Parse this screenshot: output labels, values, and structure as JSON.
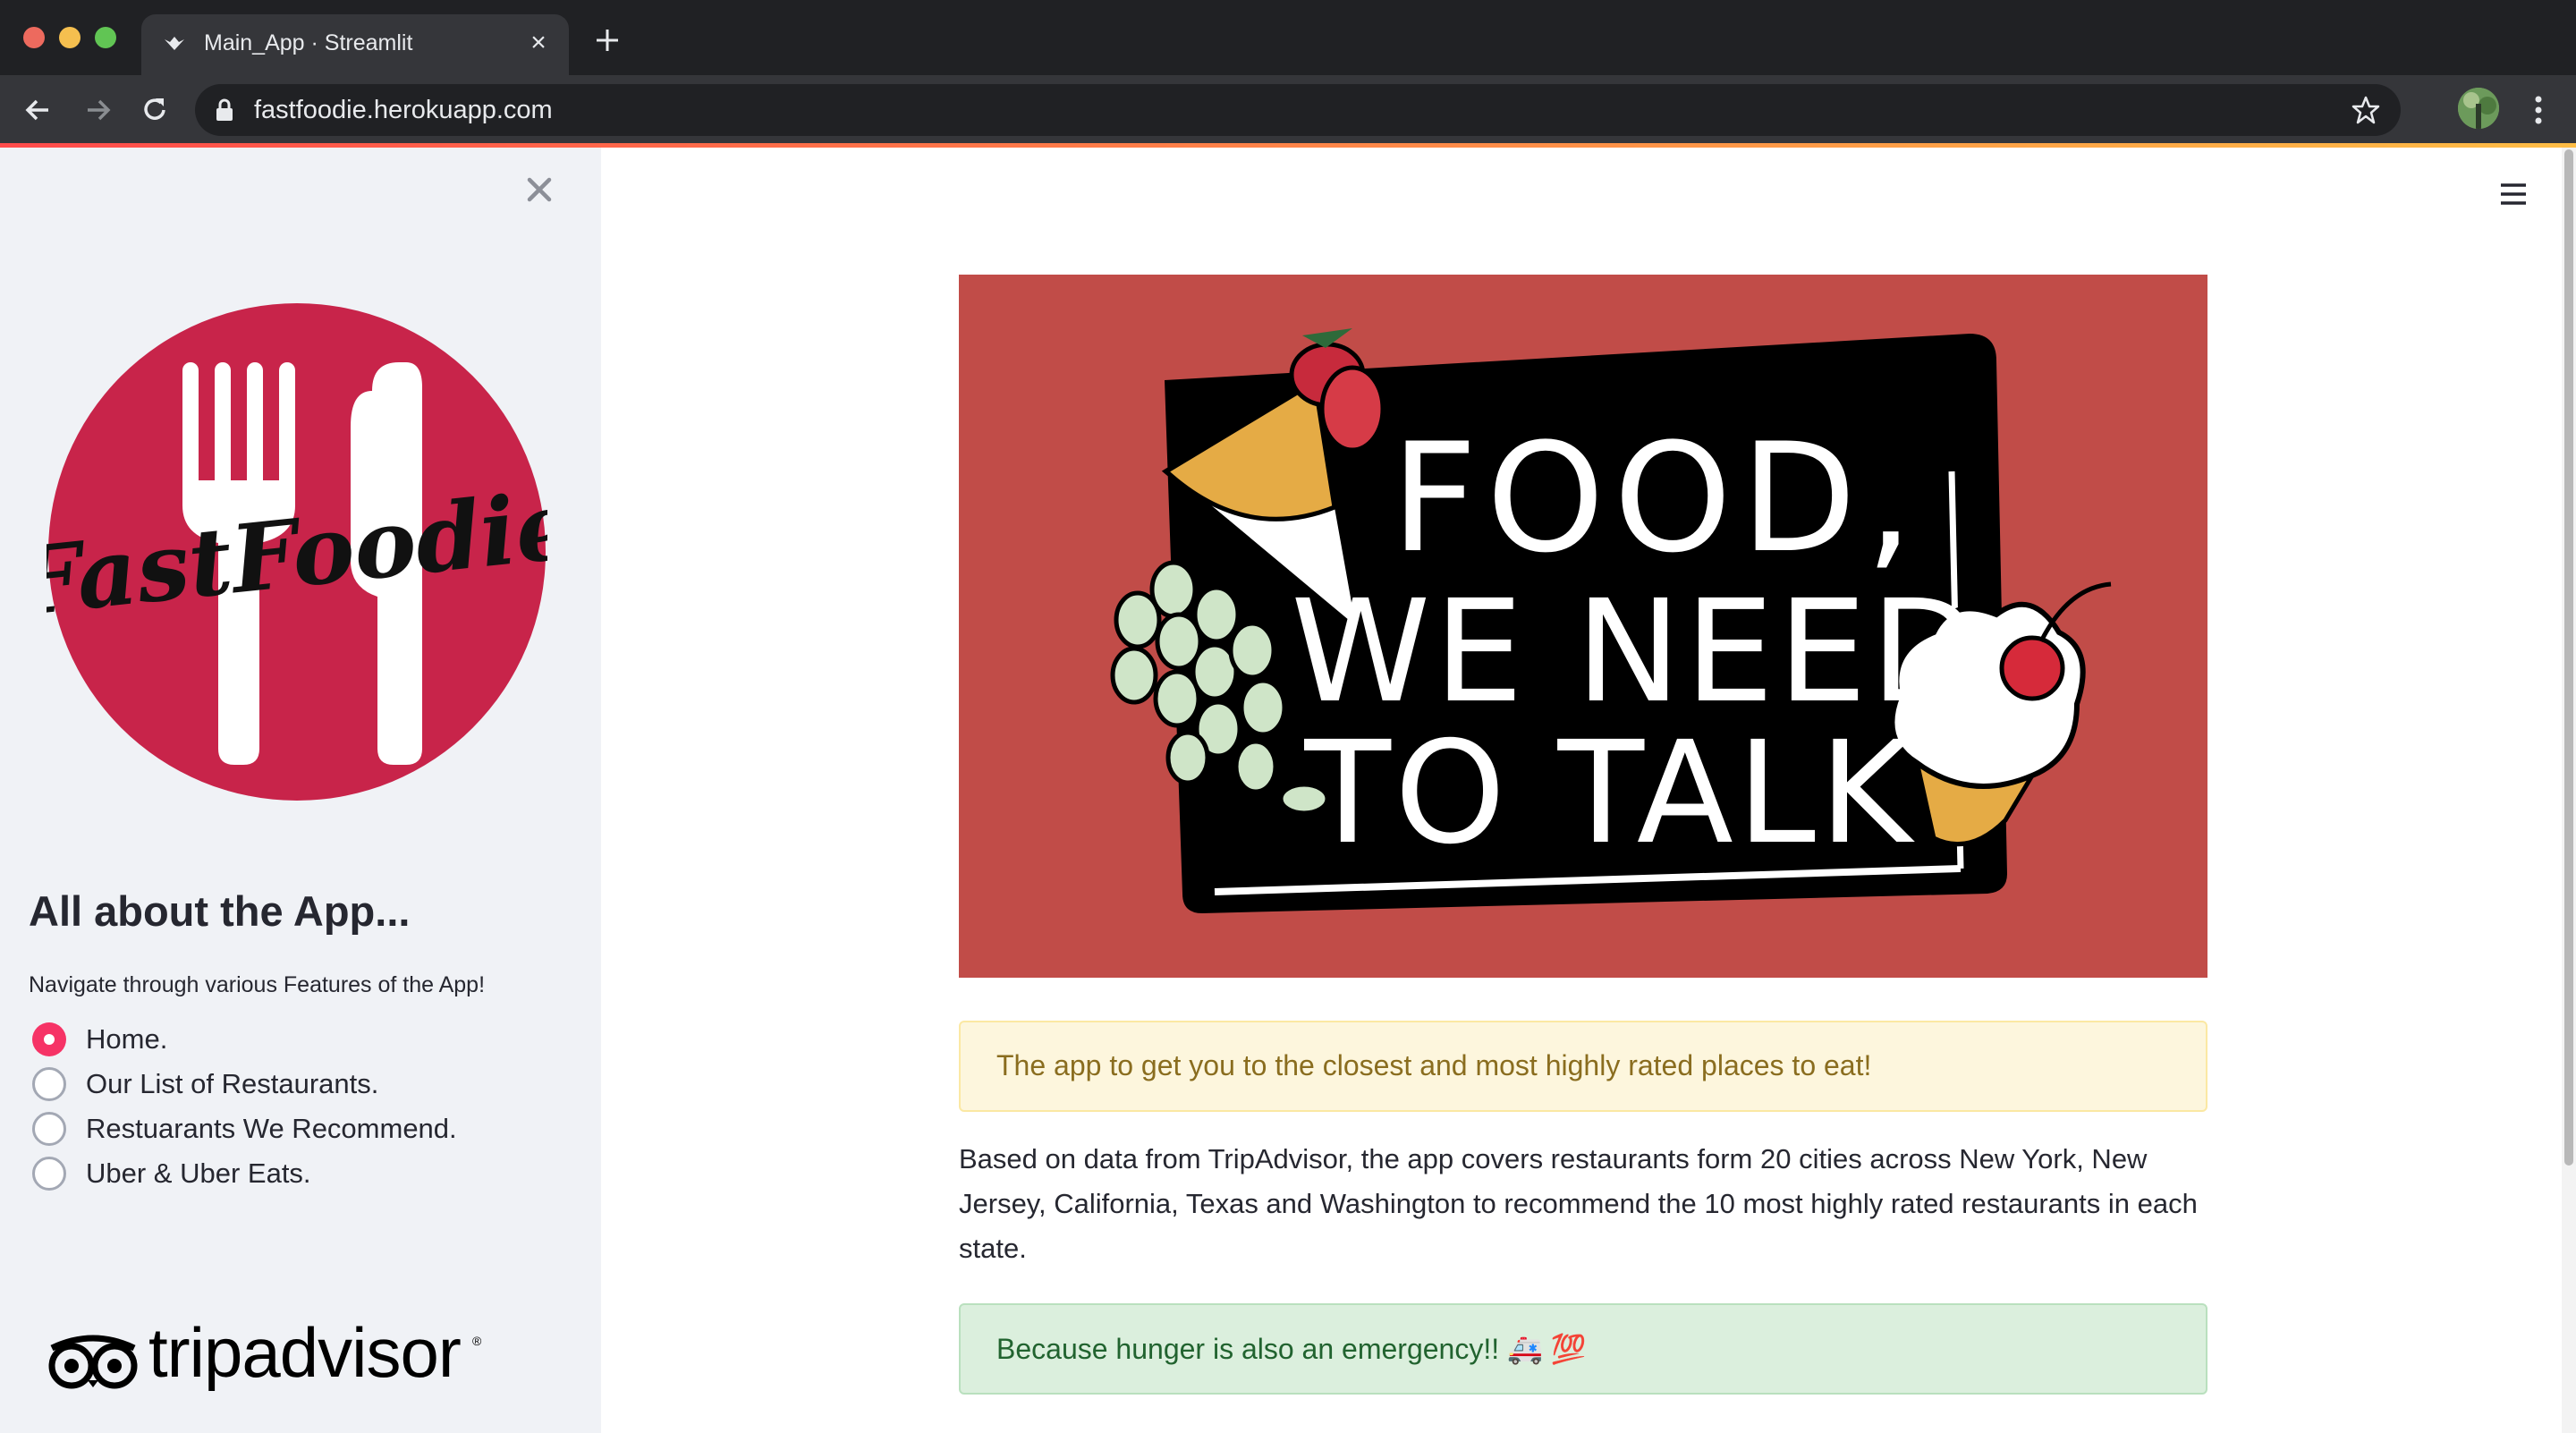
{
  "browser": {
    "tab_title": "Main_App · Streamlit",
    "url": "fastfoodie.herokuapp.com"
  },
  "sidebar": {
    "logo_text": "FastFoodie",
    "heading": "All about the App...",
    "caption": "Navigate through various Features of the App!",
    "radio_options": [
      {
        "label": "Home.",
        "selected": true
      },
      {
        "label": "Our List of Restaurants.",
        "selected": false
      },
      {
        "label": "Restuarants We Recommend.",
        "selected": false
      },
      {
        "label": "Uber & Uber Eats.",
        "selected": false
      }
    ],
    "partner_logo_text": "tripadvisor"
  },
  "main": {
    "hero_image_text": [
      "FOOD,",
      "WE NEED",
      "TO TALK"
    ],
    "warning_message": "The app to get you to the closest and most highly rated places to eat!",
    "description": "Based on data from TripAdvisor, the app covers restaurants form 20 cities across New York, New Jersey, California, Texas and Washington to recommend the 10 most highly rated restaurants in each state.",
    "success_message": "Because hunger is also an emergency!! 🚑 💯"
  },
  "colors": {
    "accent": "#f63366",
    "hero_background": "#c14c48",
    "logo_circle": "#c8244a"
  }
}
